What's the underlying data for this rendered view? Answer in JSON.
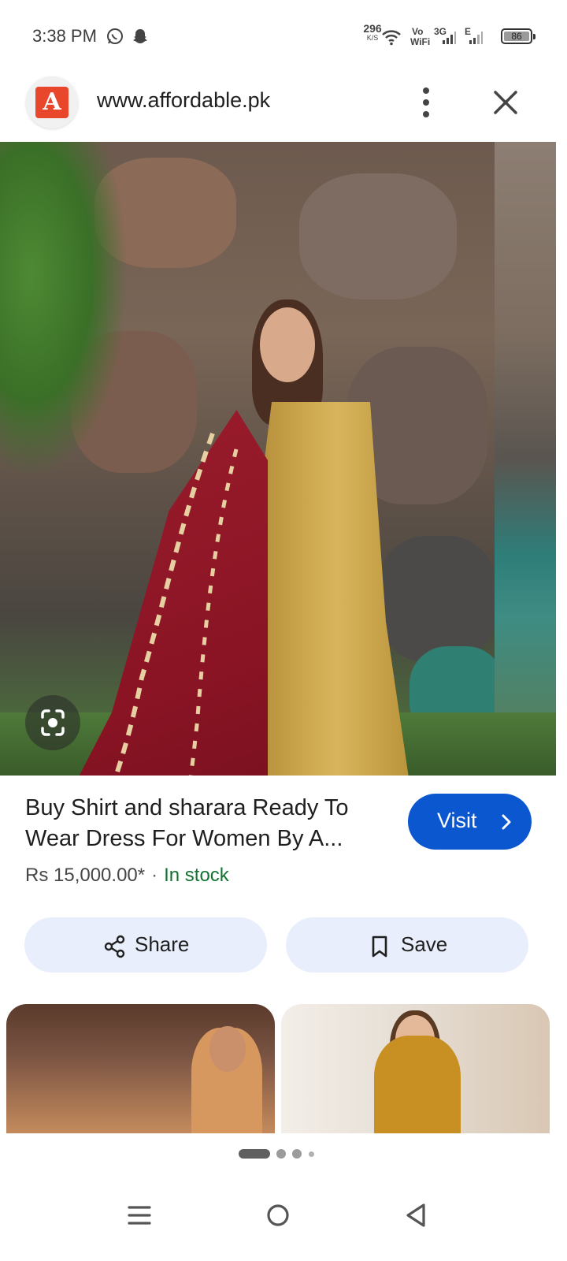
{
  "status_bar": {
    "time": "3:38 PM",
    "net_speed_value": "296",
    "net_speed_unit": "K/S",
    "vowifi_top": "Vo",
    "vowifi_bottom": "WiFi",
    "sim1_label": "3G",
    "sim2_label": "E",
    "battery": "86",
    "icons": [
      "whatsapp-icon",
      "snapchat-icon",
      "wifi-icon",
      "signal-icon",
      "battery-icon"
    ]
  },
  "site_bar": {
    "logo_letter": "A",
    "url": "www.affordable.pk",
    "logo_color": "#e8472c"
  },
  "product": {
    "title_line1": "Buy Shirt and sharara Ready To",
    "title_line2": "Wear Dress For Women By A...",
    "price": "Rs 15,000.00*",
    "separator": "·",
    "stock": "In stock",
    "visit_label": "Visit"
  },
  "actions": {
    "share_label": "Share",
    "save_label": "Save"
  },
  "pager": {
    "pages": 4,
    "active": 1
  },
  "colors": {
    "accent": "#0b57d0",
    "stock": "#137333",
    "action_bg": "#e8eefb"
  }
}
